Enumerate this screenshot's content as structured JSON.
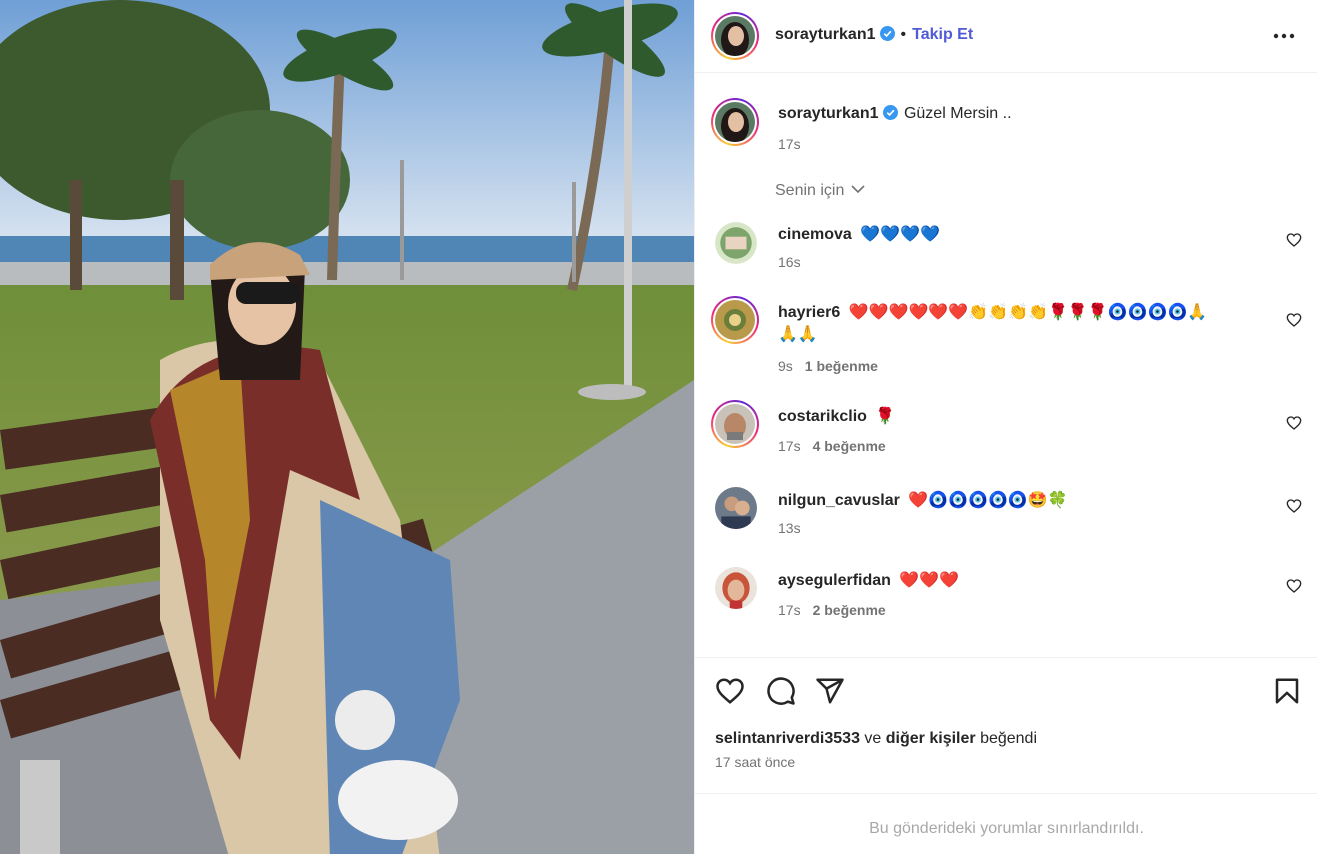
{
  "post": {
    "author": "sorayturkan1",
    "follow_label": "Takip Et",
    "separator": "•",
    "caption": "Güzel Mersin ..",
    "caption_time": "17s",
    "sort_label": "Senin için"
  },
  "comments": [
    {
      "user": "cinemova",
      "text": "💙💙💙💙",
      "time": "16s",
      "likes": ""
    },
    {
      "user": "hayrier6",
      "text": "❤️❤️❤️❤️❤️❤️👏👏👏👏🌹🌹🌹🧿🧿🧿🧿🙏",
      "text2": "🙏🙏",
      "time": "9s",
      "likes": "1 beğenme"
    },
    {
      "user": "costarikclio",
      "text": "🌹",
      "time": "17s",
      "likes": "4 beğenme"
    },
    {
      "user": "nilgun_cavuslar",
      "text": "❤️🧿🧿🧿🧿🧿🤩🍀",
      "time": "13s",
      "likes": ""
    },
    {
      "user": "aysegulerfidan",
      "text": "❤️❤️❤️",
      "time": "17s",
      "likes": "2 beğenme"
    }
  ],
  "footer": {
    "liked_user": "selintanriverdi3533",
    "liked_and": "ve",
    "liked_others": "diğer kişiler",
    "liked_suffix": "beğendi",
    "time_ago": "17 saat önce",
    "restricted": "Bu gönderideki yorumlar sınırlandırıldı."
  },
  "icons": {
    "like": "heart-icon",
    "comment": "comment-icon",
    "share": "share-icon",
    "save": "bookmark-icon",
    "more": "more-options-icon",
    "verified": "verified-badge-icon"
  },
  "colors": {
    "follow": "#4f5bd5",
    "verified": "#3897f0",
    "muted": "#737373"
  }
}
